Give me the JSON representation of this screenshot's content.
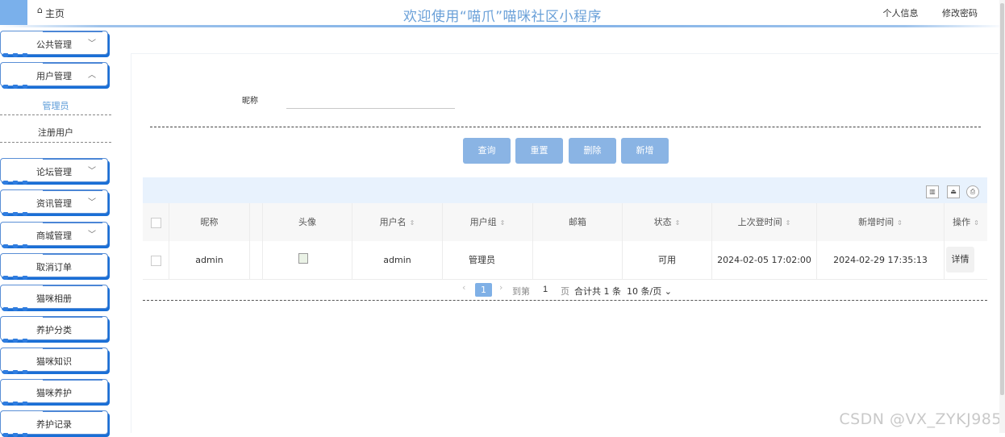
{
  "header": {
    "home_label": "主页",
    "title": "欢迎使用“喵爪”喵咪社区小程序",
    "links": [
      "个人信息",
      "修改密码"
    ]
  },
  "sidebar": {
    "menus": [
      {
        "label": "公共管理",
        "chevron": "chevron-down"
      },
      {
        "label": "用户管理",
        "chevron": "chevron-up"
      }
    ],
    "submenu": [
      "管理员",
      "注册用户"
    ],
    "active_submenu": "管理员",
    "menus2": [
      {
        "label": "论坛管理",
        "chevron": "chevron-down"
      },
      {
        "label": "资讯管理",
        "chevron": "chevron-down"
      },
      {
        "label": "商城管理",
        "chevron": "chevron-down"
      },
      {
        "label": "取消订单",
        "chevron": ""
      },
      {
        "label": "猫咪相册",
        "chevron": ""
      },
      {
        "label": "养护分类",
        "chevron": ""
      },
      {
        "label": "猫咪知识",
        "chevron": ""
      },
      {
        "label": "猫咪养护",
        "chevron": ""
      },
      {
        "label": "养护记录",
        "chevron": ""
      }
    ]
  },
  "search": {
    "label": "昵称",
    "value": "",
    "placeholder": ""
  },
  "buttons": {
    "query": "查询",
    "reset": "重置",
    "delete": "删除",
    "add": "新增"
  },
  "toolbar_icons": [
    "columns-icon",
    "export-icon",
    "print-icon"
  ],
  "table": {
    "columns": [
      "昵称",
      "头像",
      "用户名",
      "用户组",
      "邮箱",
      "状态",
      "上次登时间",
      "新增时间",
      "操作"
    ],
    "rows": [
      {
        "nickname": "admin",
        "avatar": "",
        "username": "admin",
        "group": "管理员",
        "email": "",
        "status": "可用",
        "last_login": "2024-02-05 17:02:00",
        "created": "2024-02-29 17:35:13",
        "action": "详情"
      }
    ]
  },
  "pagination": {
    "current_page": "1",
    "goto_prefix": "到第",
    "goto_value": "1",
    "goto_suffix": "页",
    "total_text": "合计共 1 条",
    "page_size": "10 条/页"
  },
  "watermark": "CSDN @VX_ZYKJ985",
  "colors": {
    "accent": "#7fb0e6",
    "button": "#8ab4e4",
    "menu_border": "#5a8fd6",
    "title": "#6aa0d8"
  }
}
